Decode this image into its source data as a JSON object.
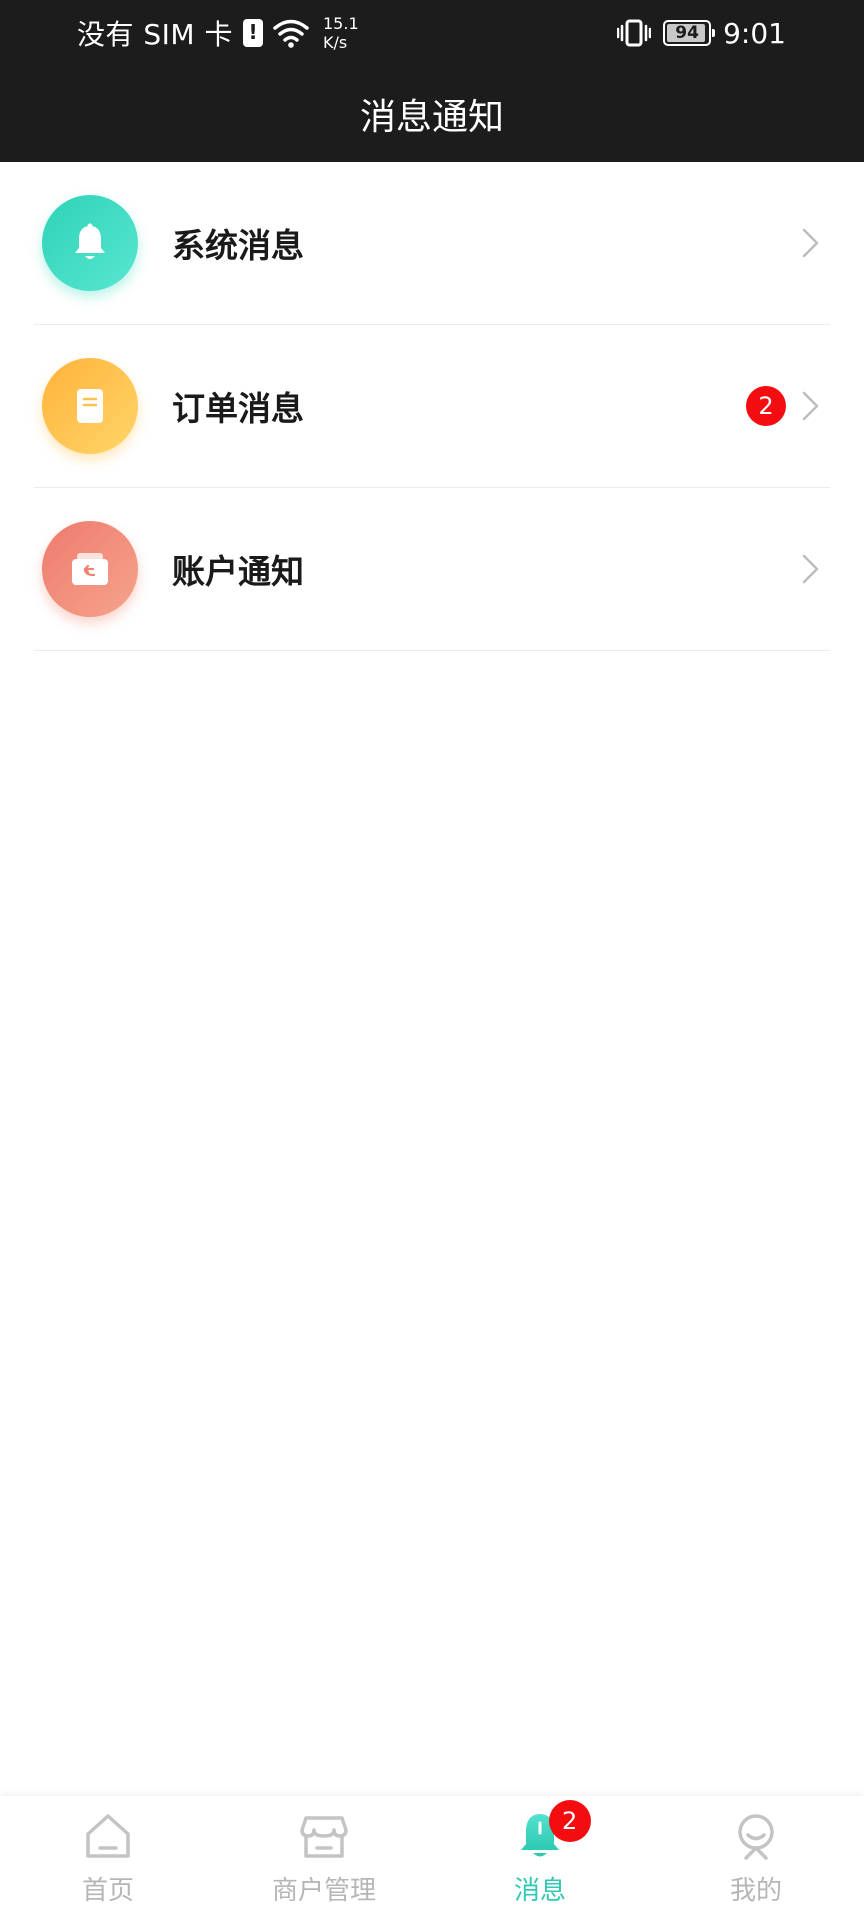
{
  "status_bar": {
    "carrier": "没有 SIM 卡",
    "net_speed_value": "15.1",
    "net_speed_unit": "K/s",
    "battery_level": "94",
    "time": "9:01"
  },
  "header": {
    "title": "消息通知"
  },
  "messages": [
    {
      "label": "系统消息",
      "icon": "bell-icon",
      "color": "#2fd3b8",
      "badge": ""
    },
    {
      "label": "订单消息",
      "icon": "order-document-icon",
      "color": "#ffb33a",
      "badge": "2"
    },
    {
      "label": "账户通知",
      "icon": "account-wallet-icon",
      "color": "#ee7a6e",
      "badge": ""
    }
  ],
  "tab_bar": {
    "active_color": "#2fc9b4",
    "inactive_color": "#b6b6b6",
    "tabs": [
      {
        "label": "首页",
        "icon": "home-icon"
      },
      {
        "label": "商户管理",
        "icon": "store-icon"
      },
      {
        "label": "消息",
        "icon": "bell-icon",
        "badge": "2",
        "active": true
      },
      {
        "label": "我的",
        "icon": "profile-icon"
      }
    ]
  }
}
